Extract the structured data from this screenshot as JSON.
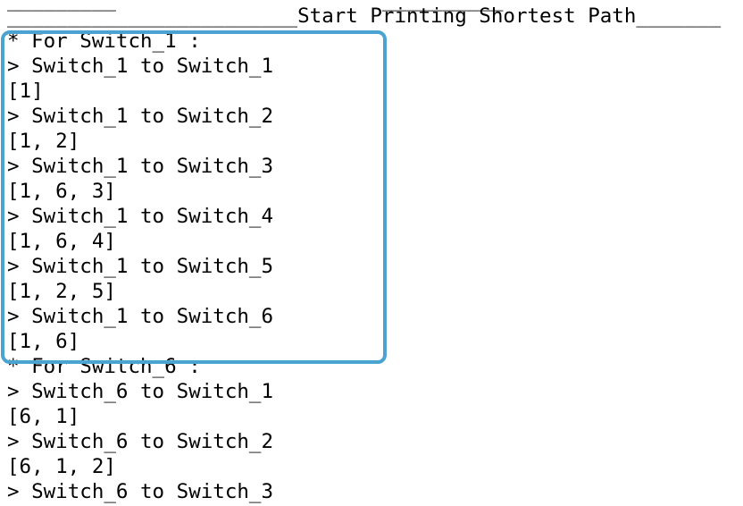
{
  "terminal": {
    "top_fragment_left": "_________",
    "top_fragment_right": "__________",
    "header": "________________________Start Printing Shortest Path_______",
    "accent_color": "#4aa3d0",
    "lines": [
      "* For Switch_1 :",
      "> Switch_1 to Switch_1",
      "[1]",
      "> Switch_1 to Switch_2",
      "[1, 2]",
      "> Switch_1 to Switch_3",
      "[1, 6, 3]",
      "> Switch_1 to Switch_4",
      "[1, 6, 4]",
      "> Switch_1 to Switch_5",
      "[1, 2, 5]",
      "> Switch_1 to Switch_6",
      "[1, 6]",
      "* For Switch_6 :",
      "> Switch_6 to Switch_1",
      "[6, 1]",
      "> Switch_6 to Switch_2",
      "[6, 1, 2]",
      "> Switch_6 to Switch_3"
    ]
  }
}
